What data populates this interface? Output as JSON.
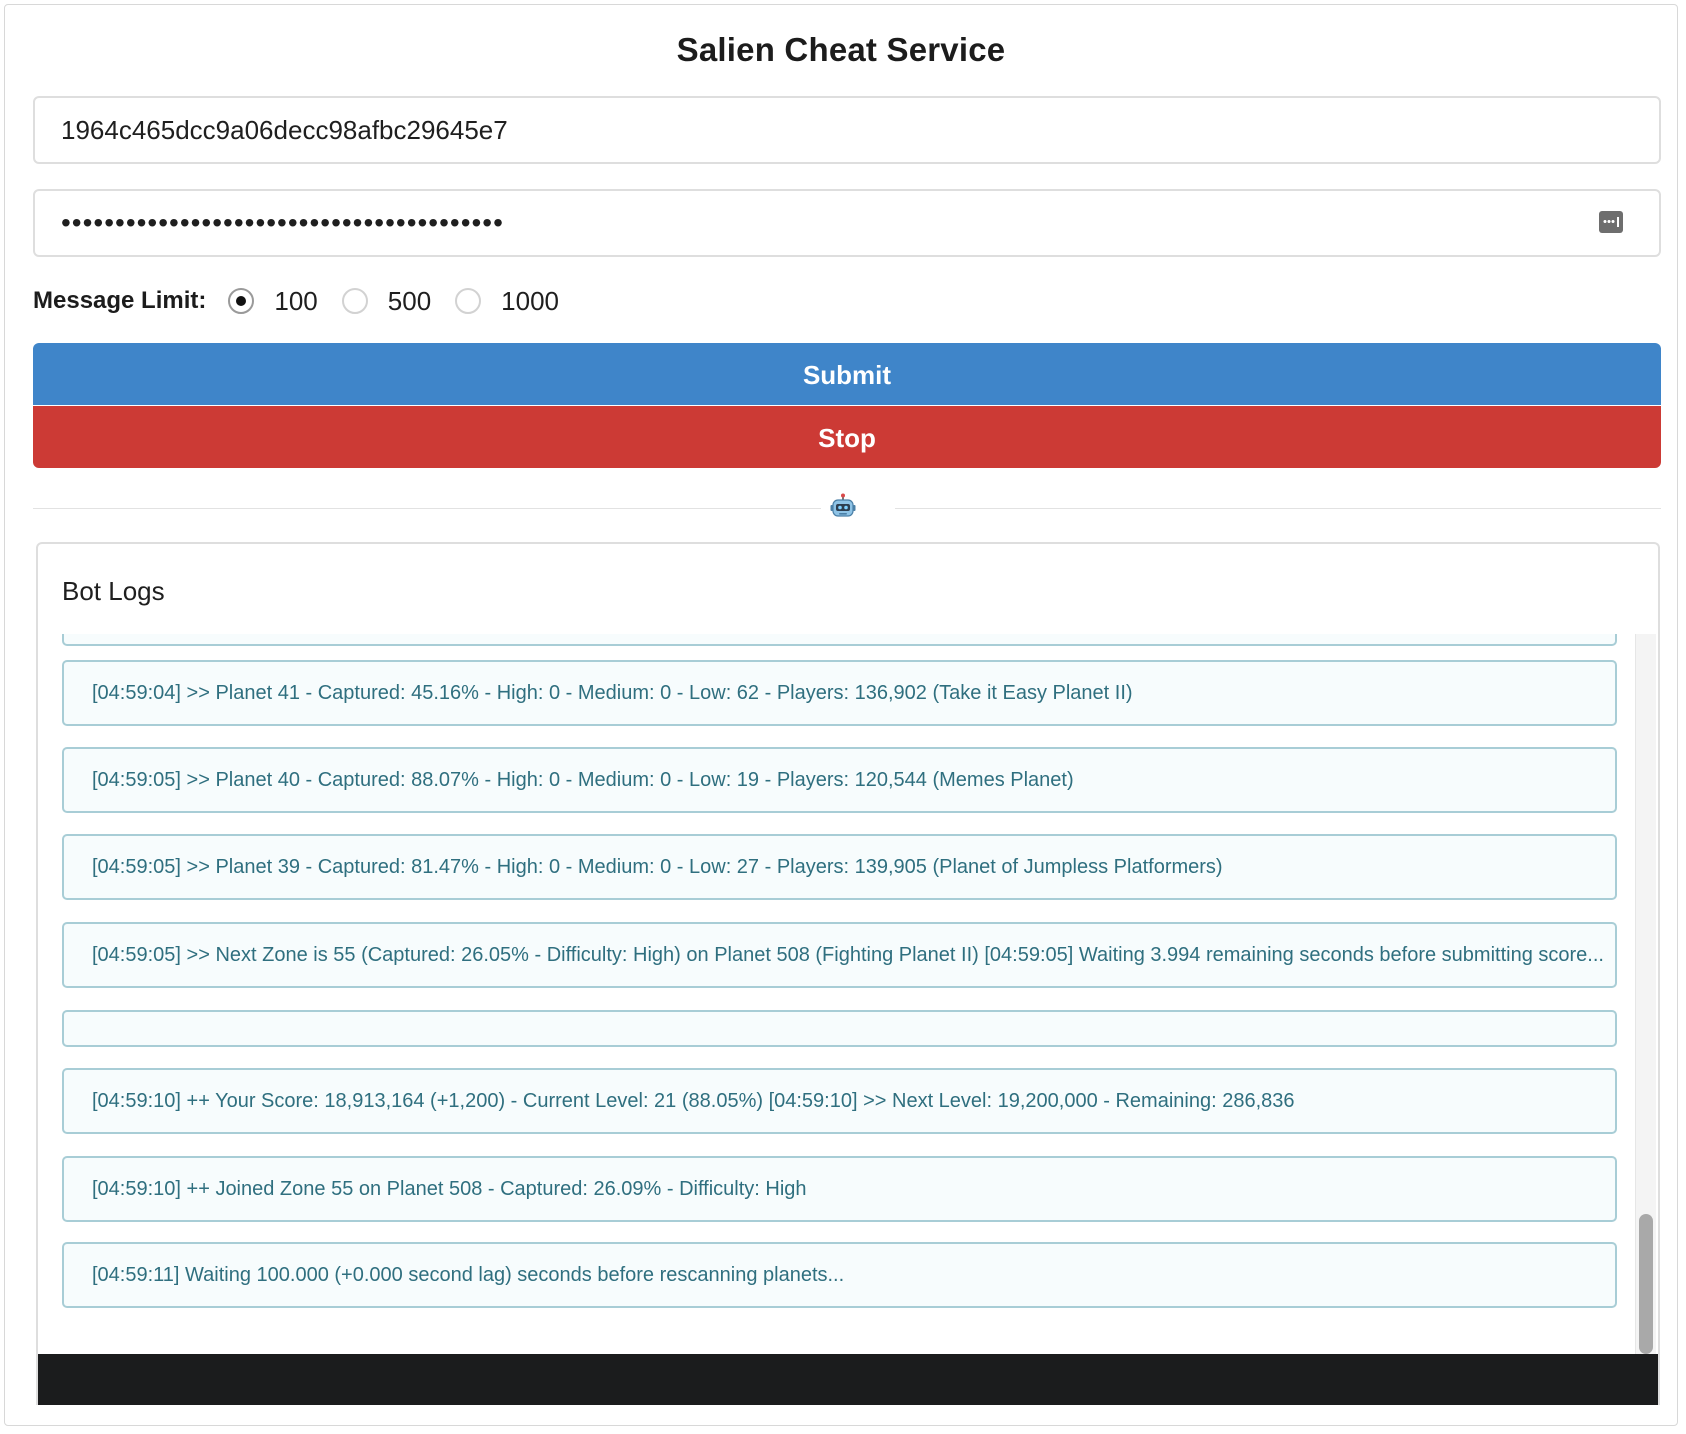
{
  "header": {
    "title": "Salien Cheat Service"
  },
  "form": {
    "session_value": "1964c465dcc9a06decc98afbc29645e7",
    "password_value": "•••••••••••••••••••••••••••••••••••••••••",
    "message_limit_label": "Message Limit:",
    "limit_options": [
      {
        "label": "100",
        "checked": true
      },
      {
        "label": "500",
        "checked": false
      },
      {
        "label": "1000",
        "checked": false
      }
    ],
    "submit_label": "Submit",
    "stop_label": "Stop"
  },
  "logs": {
    "header": "Bot Logs",
    "entries": [
      "",
      "[04:59:04] >> Planet 41 - Captured: 45.16% - High: 0 - Medium: 0 - Low: 62 - Players: 136,902 (Take it Easy Planet II)",
      "[04:59:05] >> Planet 40 - Captured: 88.07% - High: 0 - Medium: 0 - Low: 19 - Players: 120,544 (Memes Planet)",
      "[04:59:05] >> Planet 39 - Captured: 81.47% - High: 0 - Medium: 0 - Low: 27 - Players: 139,905 (Planet of Jumpless Platformers)",
      "[04:59:05] >> Next Zone is 55 (Captured: 26.05% - Difficulty: High) on Planet 508 (Fighting Planet II) [04:59:05] Waiting 3.994 remaining seconds before submitting score...",
      "",
      "[04:59:10] ++ Your Score: 18,913,164 (+1,200) - Current Level: 21 (88.05%) [04:59:10] >> Next Level: 19,200,000 - Remaining: 286,836",
      "[04:59:10] ++ Joined Zone 55 on Planet 508 - Captured: 26.09% - Difficulty: High",
      "[04:59:11] Waiting 100.000 (+0.000 second lag) seconds before rescanning planets..."
    ]
  },
  "colors": {
    "submit": "#3f85c9",
    "stop": "#cc3a35",
    "log_border": "#a8cdd6",
    "log_text": "#2f6f7f",
    "footer": "#1b1c1d"
  }
}
